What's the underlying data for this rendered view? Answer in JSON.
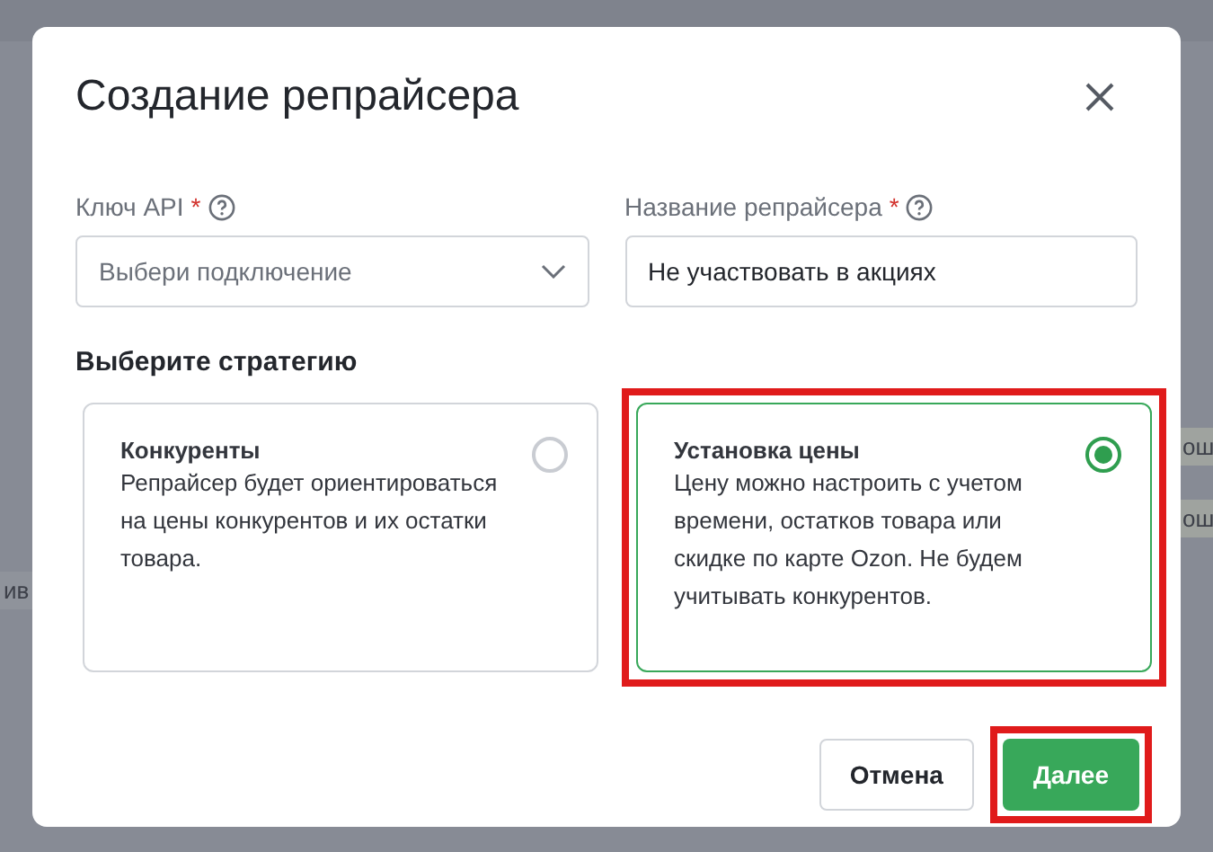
{
  "background_fragments": [
    "ош",
    "ош",
    "ив"
  ],
  "dialog": {
    "title": "Создание репрайсера",
    "fields": [
      {
        "kind": "select",
        "label": "Ключ API",
        "required_mark": "*",
        "placeholder": "Выбери подключение"
      },
      {
        "kind": "text",
        "label": "Название репрайсера",
        "required_mark": "*",
        "value": "Не участвовать в акциях"
      }
    ],
    "section_title": "Выберите стратегию",
    "strategies": [
      {
        "title": "Конкуренты",
        "description": "Репрайсер будет ориентироваться на цены конкурентов и их остатки товара.",
        "selected": false,
        "highlighted": false
      },
      {
        "title": "Установка цены",
        "description": "Цену можно настроить с учетом времени, остатков товара или скидке по карте Ozon. Не будем учитывать конкурентов.",
        "selected": true,
        "highlighted": true
      }
    ],
    "buttons": [
      {
        "kind": "secondary",
        "label": "Отмена",
        "highlighted": false
      },
      {
        "kind": "primary",
        "label": "Далее",
        "highlighted": true
      }
    ]
  }
}
